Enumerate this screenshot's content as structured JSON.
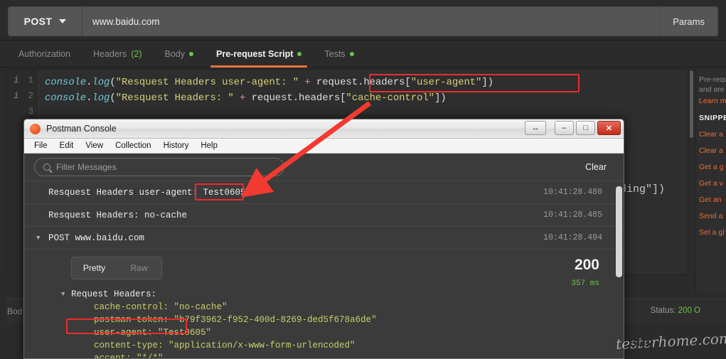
{
  "request_bar": {
    "method": "POST",
    "url": "www.baidu.com",
    "params_label": "Params"
  },
  "tabs": [
    {
      "label": "Authorization",
      "active": false,
      "dot": false,
      "count": ""
    },
    {
      "label": "Headers",
      "active": false,
      "dot": false,
      "count": "(2)"
    },
    {
      "label": "Body",
      "active": false,
      "dot": true,
      "count": ""
    },
    {
      "label": "Pre-request Script",
      "active": true,
      "dot": true,
      "count": ""
    },
    {
      "label": "Tests",
      "active": false,
      "dot": true,
      "count": ""
    }
  ],
  "editor": {
    "lines": [
      {
        "num": "1",
        "info": "i",
        "parts": [
          {
            "t": "console",
            "c": "k-cyan"
          },
          {
            "t": ".",
            "c": "k-white"
          },
          {
            "t": "log",
            "c": "k-cyan"
          },
          {
            "t": "(",
            "c": "k-plain"
          },
          {
            "t": "\"Resquest Headers user-agent: \"",
            "c": "k-yellow"
          },
          {
            "t": " + ",
            "c": "k-pink"
          },
          {
            "t": "request.headers[",
            "c": "k-plain"
          },
          {
            "t": "\"user-agent\"",
            "c": "k-yellow"
          },
          {
            "t": "])",
            "c": "k-plain"
          }
        ]
      },
      {
        "num": "2",
        "info": "i",
        "parts": [
          {
            "t": "console",
            "c": "k-cyan"
          },
          {
            "t": ".",
            "c": "k-white"
          },
          {
            "t": "log",
            "c": "k-cyan"
          },
          {
            "t": "(",
            "c": "k-plain"
          },
          {
            "t": "\"Resquest Headers: \"",
            "c": "k-yellow"
          },
          {
            "t": " + ",
            "c": "k-pink"
          },
          {
            "t": "request.headers[",
            "c": "k-plain"
          },
          {
            "t": "\"cache-control\"",
            "c": "k-yellow"
          },
          {
            "t": "])",
            "c": "k-plain"
          }
        ]
      },
      {
        "num": "3",
        "info": "",
        "parts": []
      }
    ],
    "ghost_line": "g.log(\"Resquest Headers: \" + request.headers[\"accept-encoding\"])",
    "right_fragment": "ding\"])"
  },
  "snippets_panel": {
    "desc_line1": "Pre-requ",
    "desc_line2": "and are",
    "learn_more": "Learn m",
    "section_title": "SNIPPE",
    "items": [
      "Clear a",
      "Clear a",
      "Get a g",
      "Get a v",
      "Get an",
      "Send a",
      "Set a gl"
    ]
  },
  "bottom": {
    "body_tab": "Bod",
    "status_prefix": "Status:",
    "status_value": "200 O"
  },
  "console_window": {
    "title": "Postman Console",
    "window_buttons": {
      "resize": "↔",
      "minimize": "–",
      "maximize": "□",
      "close": "✕"
    },
    "menu": [
      "File",
      "Edit",
      "View",
      "Collection",
      "History",
      "Help"
    ],
    "filter_placeholder": "Filter Messages",
    "clear_label": "Clear",
    "log_entries": [
      {
        "message": "Resquest Headers user-agent: Test0605",
        "time": "10:41:28.480",
        "caret": false
      },
      {
        "message": "Resquest Headers: no-cache",
        "time": "10:41:28.485",
        "caret": false
      },
      {
        "message": "POST www.baidu.com",
        "time": "10:41:28.494",
        "caret": true
      }
    ],
    "response": {
      "pretty_label": "Pretty",
      "raw_label": "Raw",
      "status_code": "200",
      "duration": "357 ms",
      "headers_title": "Request Headers:",
      "headers": [
        "cache-control: \"no-cache\"",
        "postman-token: \"b79f3962-f952-400d-8269-ded5f678a6de\"",
        "user-agent: \"Test0605\"",
        "content-type: \"application/x-www-form-urlencoded\"",
        "accept: \"*/*\""
      ]
    }
  },
  "annotations": {
    "highlight_color": "#ee2b2b",
    "arrow_color": "#f23a30"
  },
  "watermark": {
    "text": "testerhome.com",
    "overlay": "HTTP"
  }
}
